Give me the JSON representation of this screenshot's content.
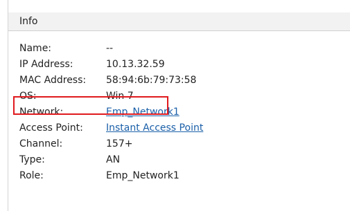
{
  "panel": {
    "title": "Info"
  },
  "rows": [
    {
      "label": "Name:",
      "value": "--",
      "link": false
    },
    {
      "label": "IP Address:",
      "value": "10.13.32.59",
      "link": false
    },
    {
      "label": "MAC Address:",
      "value": "58:94:6b:79:73:58",
      "link": false
    },
    {
      "label": "OS:",
      "value": "Win 7",
      "link": false
    },
    {
      "label": "Network:",
      "value": "Emp_Network1",
      "link": true
    },
    {
      "label": "Access Point:",
      "value": "Instant Access Point",
      "link": true
    },
    {
      "label": "Channel:",
      "value": "157+",
      "link": false
    },
    {
      "label": "Type:",
      "value": "AN",
      "link": false
    },
    {
      "label": "Role:",
      "value": "Emp_Network1",
      "link": false
    }
  ],
  "colors": {
    "highlight": "#e0191e",
    "link": "#1a5fa8",
    "header_bg": "#f2f2f2"
  }
}
